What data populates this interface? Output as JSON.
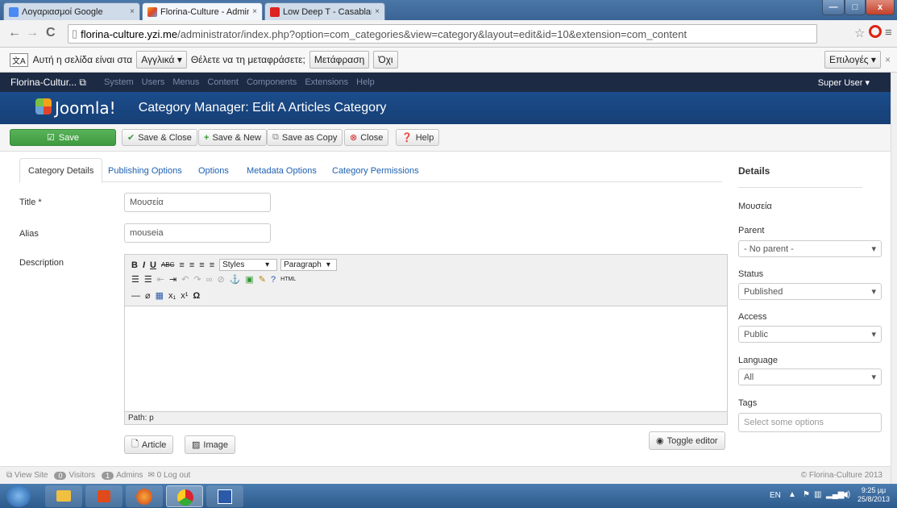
{
  "browser": {
    "tabs": [
      {
        "label": "Λογαριασμοί Google",
        "close": "×"
      },
      {
        "label": "Florina-Culture - Administ",
        "close": "×"
      },
      {
        "label": "Low Deep T - Casablanca",
        "close": "×"
      }
    ],
    "window_controls": {
      "minimize": "—",
      "maximize": "□",
      "close": "x"
    },
    "url_host": "florina-culture.yzi.me",
    "url_path": "/administrator/index.php?option=com_categories&view=category&layout=edit&id=10&extension=com_content"
  },
  "translate_bar": {
    "prompt": "Αυτή η σελίδα είναι στα",
    "language": "Αγγλικά",
    "question": "Θέλετε να τη μεταφράσετε;",
    "translate_button": "Μετάφραση",
    "no_button": "Όχι",
    "options_button": "Επιλογές",
    "close": "×"
  },
  "joomla_nav": {
    "site": "Florina-Cultur...",
    "items": [
      "System",
      "Users",
      "Menus",
      "Content",
      "Components",
      "Extensions",
      "Help"
    ],
    "user": "Super User"
  },
  "header": {
    "logo": "Joomla!",
    "title": "Category Manager: Edit A Articles Category"
  },
  "toolbar": {
    "save": "Save",
    "save_close": "Save & Close",
    "save_new": "Save & New",
    "save_copy": "Save as Copy",
    "close": "Close",
    "help": "Help"
  },
  "tabs": [
    "Category Details",
    "Publishing Options",
    "Options",
    "Metadata Options",
    "Category Permissions"
  ],
  "form": {
    "title_label": "Title *",
    "title_value": "Μουσεία",
    "alias_label": "Alias",
    "alias_value": "mouseia",
    "description_label": "Description"
  },
  "editor": {
    "styles": "Styles",
    "format": "Paragraph",
    "path": "Path: p",
    "article_btn": "Article",
    "image_btn": "Image",
    "toggle_btn": "Toggle editor"
  },
  "details": {
    "heading": "Details",
    "name": "Μουσεία",
    "parent_label": "Parent",
    "parent_value": "- No parent -",
    "status_label": "Status",
    "status_value": "Published",
    "access_label": "Access",
    "access_value": "Public",
    "language_label": "Language",
    "language_value": "All",
    "tags_label": "Tags",
    "tags_placeholder": "Select some options"
  },
  "footer": {
    "view_site": "View Site",
    "visitors_count": "0",
    "visitors": "Visitors",
    "admins_count": "1",
    "admins": "Admins",
    "logout": "0 Log out",
    "copyright": "© Florina-Culture 2013"
  },
  "taskbar": {
    "lang": "EN",
    "time": "9:25 μμ",
    "date": "25/8/2013"
  },
  "colors": {
    "joomla_nav": "#1d2a44",
    "joomla_header": "#1b4d8c",
    "save_green": "#46a546",
    "link_blue": "#2061b0"
  }
}
